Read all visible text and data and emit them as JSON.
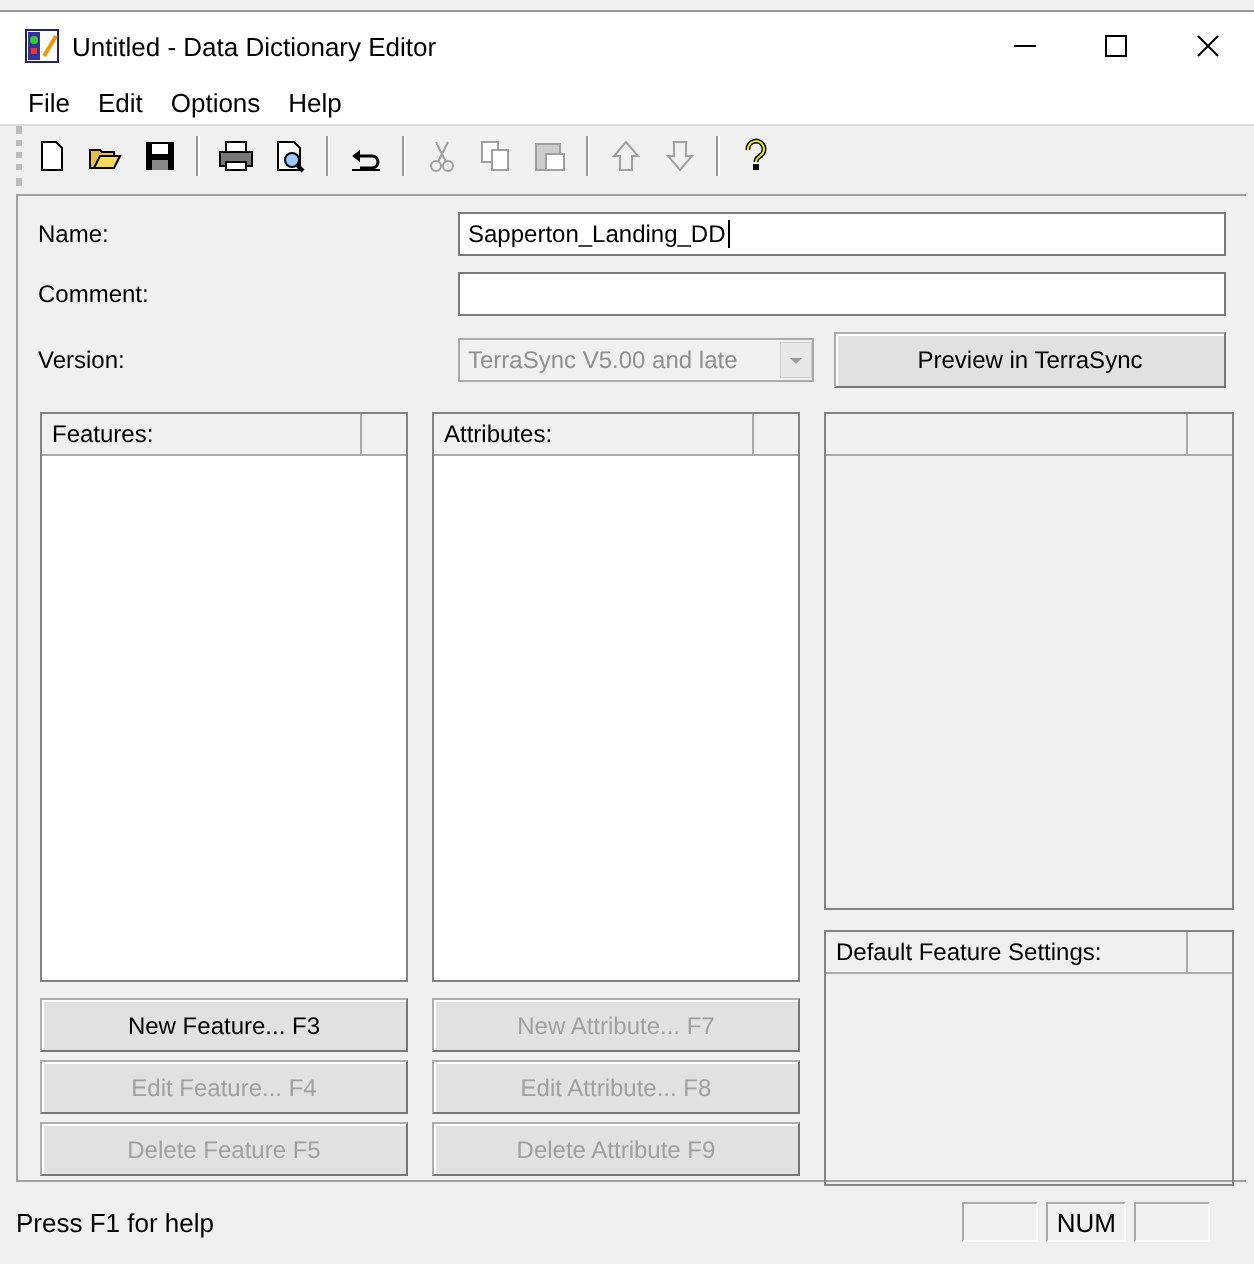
{
  "window": {
    "title": "Untitled - Data Dictionary Editor"
  },
  "menu": [
    "File",
    "Edit",
    "Options",
    "Help"
  ],
  "toolbar": [
    {
      "kind": "new",
      "disabled": false
    },
    {
      "kind": "open",
      "disabled": false
    },
    {
      "kind": "save",
      "disabled": false
    },
    {
      "kind": "sep"
    },
    {
      "kind": "print",
      "disabled": false
    },
    {
      "kind": "preview",
      "disabled": false
    },
    {
      "kind": "sep"
    },
    {
      "kind": "undo",
      "disabled": false
    },
    {
      "kind": "sep"
    },
    {
      "kind": "cut",
      "disabled": true
    },
    {
      "kind": "copy",
      "disabled": true
    },
    {
      "kind": "paste",
      "disabled": true
    },
    {
      "kind": "sep"
    },
    {
      "kind": "up",
      "disabled": true
    },
    {
      "kind": "down",
      "disabled": true
    },
    {
      "kind": "sep"
    },
    {
      "kind": "help",
      "disabled": false
    }
  ],
  "form": {
    "name": {
      "label": "Name:",
      "value": "Sapperton_Landing_DD"
    },
    "comment": {
      "label": "Comment:"
    },
    "version": {
      "label": "Version:",
      "value": "TerraSync V5.00 and late",
      "disabled": true
    },
    "preview_button": {
      "label": "Preview in TerraSync",
      "disabled": false
    }
  },
  "features": {
    "header": "Features:",
    "buttons": [
      {
        "label": "New Feature... F3",
        "disabled": false
      },
      {
        "label": "Edit Feature... F4",
        "disabled": true
      },
      {
        "label": "Delete Feature F5",
        "disabled": true
      }
    ]
  },
  "attributes": {
    "header": "Attributes:",
    "buttons": [
      {
        "label": "New Attribute... F7",
        "disabled": true
      },
      {
        "label": "Edit Attribute... F8",
        "disabled": true
      },
      {
        "label": "Delete Attribute F9",
        "disabled": true
      }
    ]
  },
  "default_settings": {
    "header": "Default Feature Settings:"
  },
  "status_bar": {
    "text": "Press F1 for help",
    "indicators": [
      "NUM"
    ]
  }
}
